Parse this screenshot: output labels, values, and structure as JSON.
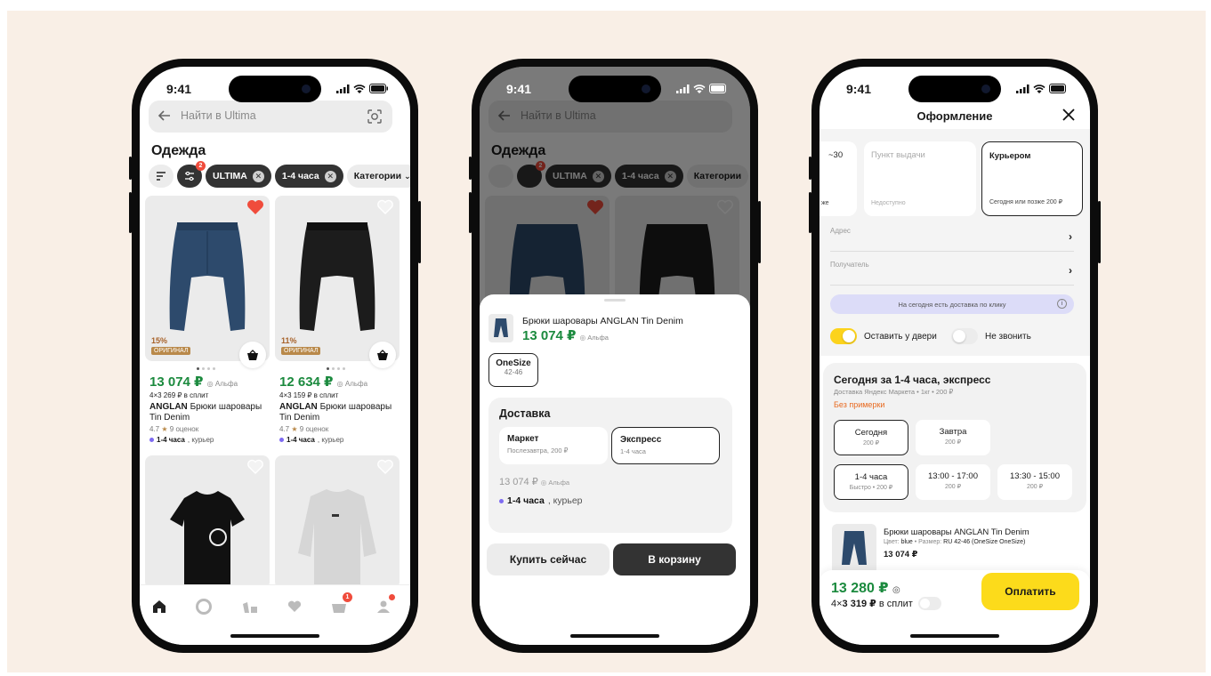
{
  "status": {
    "time": "9:41"
  },
  "catalog": {
    "search_placeholder": "Найти в Ultima",
    "title": "Одежда",
    "filter_badge": "2",
    "chips": [
      {
        "label": "ULTIMA"
      },
      {
        "label": "1-4 часа"
      },
      {
        "label": "Категории"
      }
    ],
    "products": [
      {
        "discount": "15%",
        "original_badge": "ОРИГИНАЛ",
        "price": "13 074 ₽",
        "bank": "Альфа",
        "split": "4×3 269 ₽ в сплит",
        "brand": "ANGLAN",
        "name": "Брюки шаровары Tin Denim",
        "rating": "4.7",
        "reviews": "9 оценок",
        "delivery_time": "1-4 часа",
        "delivery_method": ", курьер",
        "favorite": true,
        "color": "#2d4a6c"
      },
      {
        "discount": "11%",
        "original_badge": "ОРИГИНАЛ",
        "price": "12 634 ₽",
        "bank": "Альфа",
        "split": "4×3 159 ₽ в сплит",
        "brand": "ANGLAN",
        "name": "Брюки шаровары Tin Denim",
        "rating": "4.7",
        "reviews": "9 оценок",
        "delivery_time": "1-4 часа",
        "delivery_method": ", курьер",
        "favorite": false,
        "color": "#1c1c1c"
      }
    ],
    "tab_badges": {
      "cart": "1"
    }
  },
  "sheet": {
    "product_name": "Брюки шаровары ANGLAN Tin Denim",
    "price": "13 074 ₽",
    "bank": "Альфа",
    "size_label": "OneSize",
    "size_range": "42-46",
    "delivery_title": "Доставка",
    "options": [
      {
        "name": "Маркет",
        "detail": "Послезавтра, 200 ₽"
      },
      {
        "name": "Экспресс",
        "detail": "1-4 часа"
      }
    ],
    "price_line": "13 074 ₽",
    "delivery_time": "1-4 часа",
    "delivery_method": ", курьер",
    "buy_now": "Купить сейчас",
    "add_to_cart": "В корзину"
  },
  "checkout": {
    "title": "Оформление",
    "methods": [
      {
        "title": "~30",
        "sub": "же"
      },
      {
        "title": "Пункт выдачи",
        "sub": "Недоступно"
      },
      {
        "title": "Курьером",
        "sub": "Сегодня или позже 200 ₽"
      }
    ],
    "address_label": "Адрес",
    "recipient_label": "Получатель",
    "promo": "На сегодня есть доставка по клику",
    "toggle_door": "Оставить у двери",
    "toggle_no_call": "Не звонить",
    "express_title": "Сегодня за 1-4 часа, экспресс",
    "express_sub": "Доставка Яндекс Маркета • 1кг • 200 ₽",
    "express_warning": "Без примерки",
    "slots": [
      {
        "t": "Сегодня",
        "s": "200 ₽"
      },
      {
        "t": "Завтра",
        "s": "200 ₽"
      },
      {
        "t": "1-4 часа",
        "s": "Быстро • 200 ₽"
      },
      {
        "t": "13:00 - 17:00",
        "s": "200 ₽"
      },
      {
        "t": "13:30 - 15:00",
        "s": "200 ₽"
      }
    ],
    "item_name": "Брюки шаровары ANGLAN Tin Denim",
    "item_color_label": "Цвет:",
    "item_color": "blue",
    "item_size_label": " • Размер:",
    "item_size": "RU 42-46 (OneSize OneSize)",
    "item_price": "13 074 ₽",
    "total": "13 280 ₽",
    "split_prefix": "4×",
    "split_amount": "3 319 ₽",
    "split_suffix": "в сплит",
    "pay": "Оплатить"
  },
  "colors": {
    "price_green": "#1b8a3e",
    "pay_yellow": "#fcdb1b",
    "badge_red": "#f04c3c"
  }
}
